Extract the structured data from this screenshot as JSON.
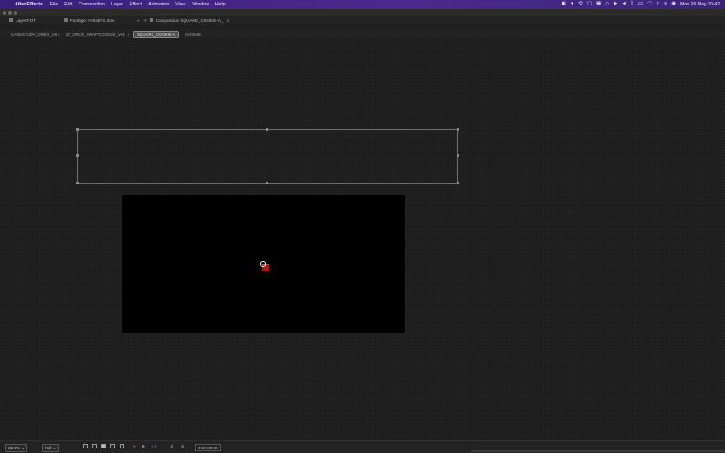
{
  "menubar": {
    "app_name": "After Effects",
    "items": [
      "File",
      "Edit",
      "Composition",
      "Layer",
      "Effect",
      "Animation",
      "View",
      "Window",
      "Help"
    ],
    "clock": "Mon 26 May  20:42"
  },
  "panel_tabs": [
    {
      "label": "Layer:FOT"
    },
    {
      "label": "Footage: FerlabFX.mov"
    },
    {
      "label": "Composition SQUARE_COOKIE-A_"
    }
  ],
  "viewer_tabs": [
    {
      "label": "CASESTUDY_OREO_V8"
    },
    {
      "label": "07_OREO_CRAFTCOOKIE_V02"
    },
    {
      "label": "SQUARE_COOKIE-A"
    },
    {
      "label": "COOKIE"
    }
  ],
  "bottom": {
    "zoom": "22.5%",
    "resolution": "Full",
    "timecode": "0:00:00:00"
  }
}
